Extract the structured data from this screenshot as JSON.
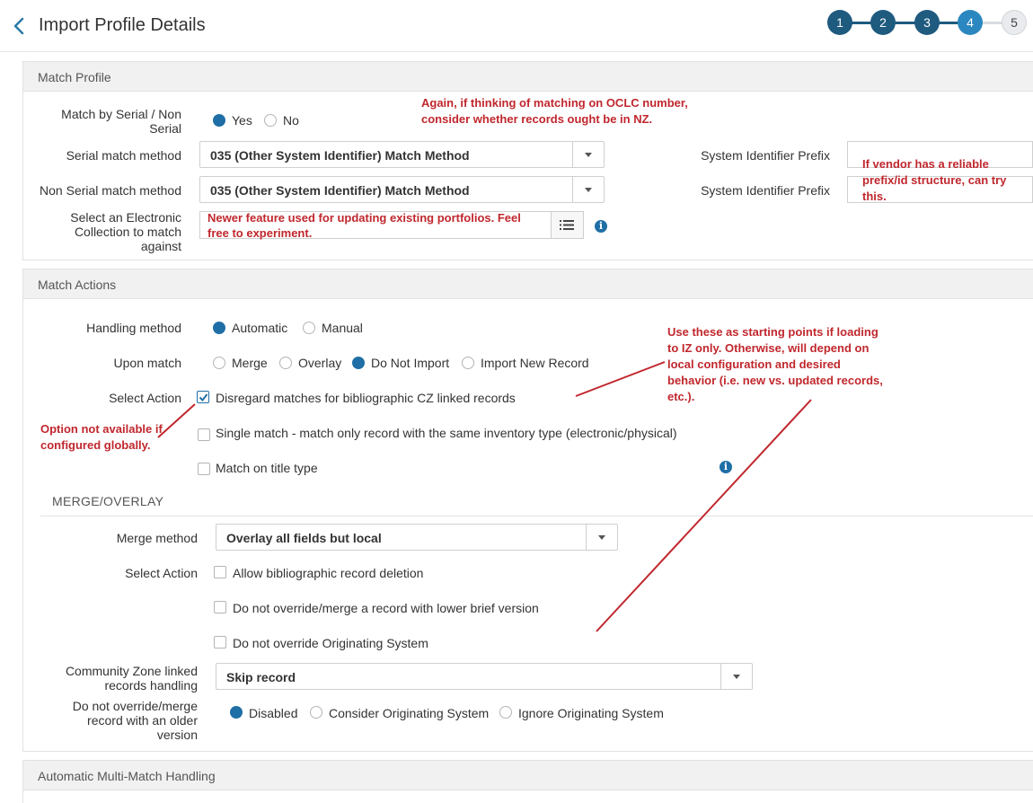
{
  "header": {
    "title": "Import Profile Details",
    "steps": [
      "1",
      "2",
      "3",
      "4",
      "5"
    ]
  },
  "match_profile": {
    "title": "Match Profile",
    "match_by_serial_label": "Match by Serial / Non Serial",
    "yes_label": "Yes",
    "no_label": "No",
    "serial_method_label": "Serial match method",
    "serial_method_value": "035 (Other System Identifier) Match Method",
    "non_serial_method_label": "Non Serial match method",
    "non_serial_method_value": "035 (Other System Identifier) Match Method",
    "sys_prefix_label_1": "System Identifier Prefix",
    "sys_prefix_label_2": "System Identifier Prefix",
    "electronic_collection_label": "Select an Electronic Collection to match against"
  },
  "match_actions": {
    "title": "Match Actions",
    "handling_label": "Handling method",
    "automatic_label": "Automatic",
    "manual_label": "Manual",
    "upon_match_label": "Upon match",
    "merge_label": "Merge",
    "overlay_label": "Overlay",
    "do_not_import_label": "Do Not Import",
    "import_new_label": "Import New Record",
    "select_action_label": "Select Action",
    "disregard_label": "Disregard matches for bibliographic CZ linked records",
    "single_match_label": "Single match - match only record with the same inventory type (electronic/physical)",
    "title_type_label": "Match on title type",
    "merge_overlay_heading": "MERGE/OVERLAY",
    "merge_method_label": "Merge method",
    "merge_method_value": "Overlay all fields but local",
    "select_action_label_2": "Select Action",
    "allow_deletion_label": "Allow bibliographic record deletion",
    "lower_brief_label": "Do not override/merge a record with lower brief version",
    "originating_label": "Do not override Originating System",
    "cz_handling_label": "Community Zone linked records handling",
    "cz_handling_value": "Skip record",
    "older_version_label": "Do not override/merge record with an older version",
    "disabled_label": "Disabled",
    "consider_label": "Consider Originating System",
    "ignore_label": "Ignore Originating System"
  },
  "multi_match": {
    "title": "Automatic Multi-Match Handling"
  },
  "annotations": {
    "oclc_note": "Again, if thinking of matching on OCLC number, consider whether records ought be in NZ.",
    "prefix_note": "If vendor has a reliable prefix/id structure, can try this.",
    "portfolio_note": "Newer feature used for updating existing portfolios. Feel free to experiment.",
    "starting_points_note": "Use these as starting points if loading to IZ only. Otherwise, will depend on local configuration and desired behavior (i.e. new vs. updated records, etc.).",
    "global_note": "Option not available if configured globally."
  },
  "colors": {
    "accent": "#1f6fa6",
    "step_done": "#1f5a7f",
    "annotation": "#c0272d"
  }
}
